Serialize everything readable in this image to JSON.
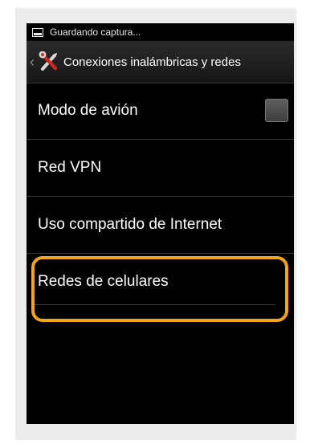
{
  "statusbar": {
    "text": "Guardando captura..."
  },
  "titlebar": {
    "title": "Conexiones inalámbricas y redes"
  },
  "settings": {
    "items": [
      {
        "label": "Modo de avión",
        "checked": false
      },
      {
        "label": "Red VPN"
      },
      {
        "label": "Uso compartido de Internet"
      },
      {
        "label": "Redes de celulares"
      }
    ]
  },
  "colors": {
    "highlight": "#f2a516",
    "screen_bg": "#000000",
    "frame_bg": "#ececee"
  }
}
